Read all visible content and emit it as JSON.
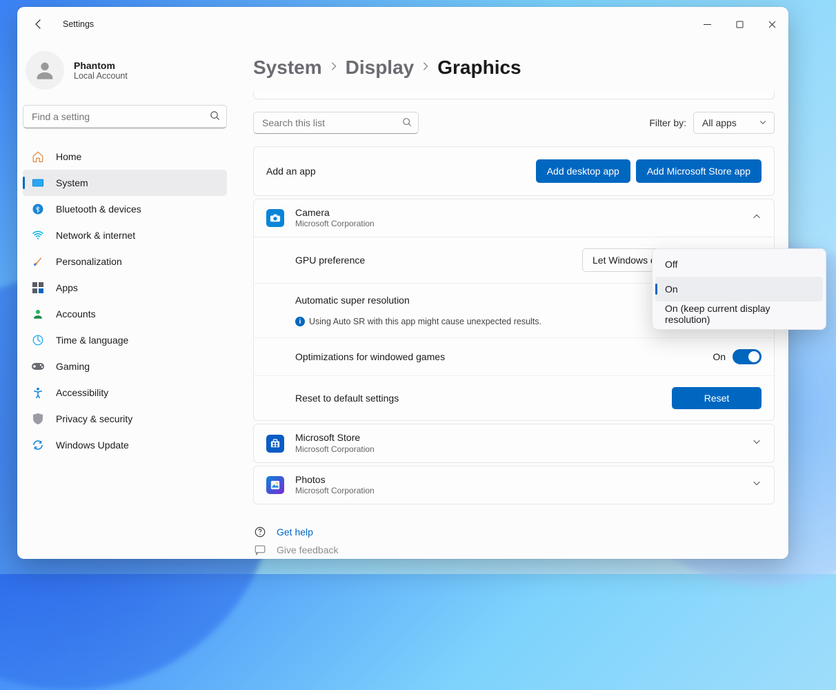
{
  "window": {
    "title": "Settings"
  },
  "user": {
    "name": "Phantom",
    "subtitle": "Local Account"
  },
  "sidebar_search_placeholder": "Find a setting",
  "nav": {
    "items": [
      {
        "label": "Home"
      },
      {
        "label": "System"
      },
      {
        "label": "Bluetooth & devices"
      },
      {
        "label": "Network & internet"
      },
      {
        "label": "Personalization"
      },
      {
        "label": "Apps"
      },
      {
        "label": "Accounts"
      },
      {
        "label": "Time & language"
      },
      {
        "label": "Gaming"
      },
      {
        "label": "Accessibility"
      },
      {
        "label": "Privacy & security"
      },
      {
        "label": "Windows Update"
      }
    ],
    "selected_index": 1
  },
  "breadcrumb": {
    "items": [
      "System",
      "Display",
      "Graphics"
    ]
  },
  "list": {
    "search_placeholder": "Search this list",
    "filter_label": "Filter by:",
    "filter_value": "All apps"
  },
  "add_app": {
    "label": "Add an app",
    "btn_desktop": "Add desktop app",
    "btn_store": "Add Microsoft Store app"
  },
  "apps": {
    "camera": {
      "name": "Camera",
      "publisher": "Microsoft Corporation",
      "expanded": true,
      "rows": {
        "gpu_pref_label": "GPU preference",
        "gpu_pref_value": "Let Windows decide (Power saving)",
        "asr_label": "Automatic super resolution",
        "asr_info": "Using Auto SR with this app might cause unexpected results.",
        "windowed_label": "Optimizations for windowed games",
        "windowed_toggle_text": "On",
        "windowed_toggle_on": true,
        "reset_label": "Reset to default settings",
        "reset_btn": "Reset"
      }
    },
    "store": {
      "name": "Microsoft Store",
      "publisher": "Microsoft Corporation"
    },
    "photos": {
      "name": "Photos",
      "publisher": "Microsoft Corporation"
    }
  },
  "context_menu": {
    "items": [
      {
        "label": "Off"
      },
      {
        "label": "On"
      },
      {
        "label": "On (keep current display resolution)"
      }
    ],
    "highlight_index": 1
  },
  "footer": {
    "help": "Get help",
    "feedback": "Give feedback"
  }
}
